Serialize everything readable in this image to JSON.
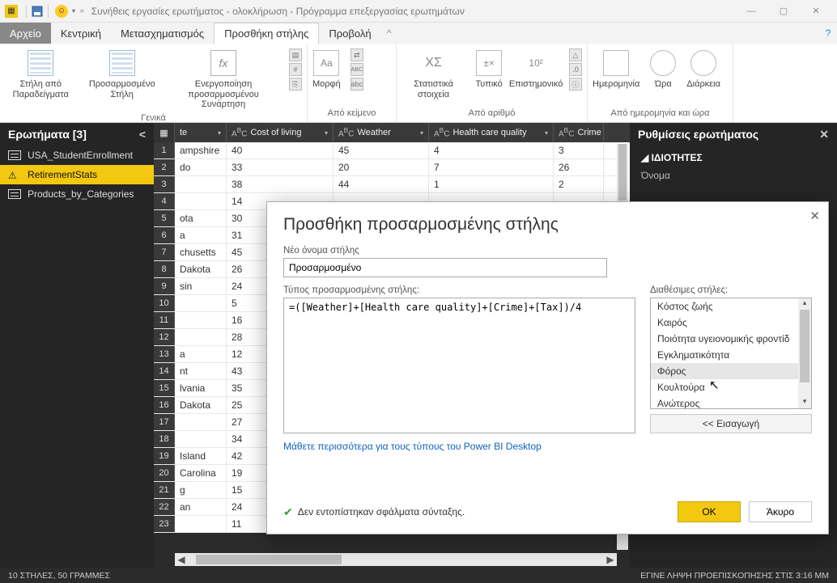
{
  "title": "Συνήθεις εργασίες ερωτήματος - ολοκλήρωση - Πρόγραμμα επεξεργασίας ερωτημάτων",
  "menu": {
    "file": "Αρχείο",
    "home": "Κεντρική",
    "transform": "Μετασχηματισμός",
    "add": "Προσθήκη στήλης",
    "view": "Προβολή"
  },
  "ribbon": {
    "g_general": "Γενικά",
    "g_text": "Από κείμενο",
    "g_number": "Από αριθμό",
    "g_date": "Από ημερομηνία και ώρα",
    "col_examples": "Στήλη από Παραδείγματα",
    "custom_col": "Προσαρμοσμένο Στήλη",
    "invoke": "Ενεργοποίηση προσαρμοσμένου Συνάρτηση",
    "format": "Μορφή",
    "stats": "Στατιστικά στοιχεία",
    "standard": "Τυπικό",
    "scientific": "Επιστημονικό",
    "date": "Ημερομηνία",
    "time": "Ώρα",
    "duration": "Διάρκεια"
  },
  "queries": {
    "header": "Ερωτήματα [3]",
    "items": [
      "USA_StudentEnrollment",
      "RetirementStats",
      "Products_by_Categories"
    ]
  },
  "columns": [
    "te",
    "Cost of living",
    "Weather",
    "Health care quality",
    "Crime"
  ],
  "rows": [
    [
      "ampshire",
      "40",
      "45",
      "4",
      "3"
    ],
    [
      "do",
      "33",
      "20",
      "7",
      "26"
    ],
    [
      "",
      "38",
      "44",
      "1",
      "2"
    ],
    [
      "",
      "14",
      "",
      "",
      ""
    ],
    [
      "ota",
      "30",
      "",
      "",
      ""
    ],
    [
      "a",
      "31",
      "",
      "",
      ""
    ],
    [
      "chusetts",
      "45",
      "",
      "",
      ""
    ],
    [
      "Dakota",
      "26",
      "",
      "",
      ""
    ],
    [
      "sin",
      "24",
      "",
      "",
      ""
    ],
    [
      "",
      "5",
      "",
      "",
      ""
    ],
    [
      "",
      "16",
      "",
      "",
      ""
    ],
    [
      "",
      "28",
      "",
      "",
      ""
    ],
    [
      "a",
      "12",
      "",
      "",
      ""
    ],
    [
      "nt",
      "43",
      "",
      "",
      ""
    ],
    [
      "lvania",
      "35",
      "",
      "",
      ""
    ],
    [
      "Dakota",
      "25",
      "",
      "",
      ""
    ],
    [
      "",
      "27",
      "",
      "",
      ""
    ],
    [
      "",
      "34",
      "",
      "",
      ""
    ],
    [
      "Island",
      "42",
      "",
      "",
      ""
    ],
    [
      "Carolina",
      "19",
      "",
      "",
      ""
    ],
    [
      "g",
      "15",
      "",
      "",
      ""
    ],
    [
      "an",
      "24",
      "",
      "",
      ""
    ],
    [
      "",
      "11",
      "",
      "",
      ""
    ]
  ],
  "settings": {
    "header": "Ρυθμίσεις ερωτήματος",
    "properties": "ΙΔΙΟΤΗΤΕΣ",
    "name": "Όνομα"
  },
  "status": {
    "left": "10 ΣΤΗΛΕΣ, 50 ΓΡΑΜΜΕΣ",
    "right": "ΕΓΙΝΕ ΛΗΨΗ ΠΡΟΕΠΙΣΚΟΠΗΣΗΣ ΣΤΙΣ 3:16 ΜΜ"
  },
  "dialog": {
    "title": "Προσθήκη προσαρμοσμένης στήλης",
    "name_label": "Νέο όνομα στήλης",
    "name_value": "Προσαρμοσμένο",
    "formula_label": "Τύπος προσαρμοσμένης στήλης:",
    "formula_value": "=([Weather]+[Health care quality]+[Crime]+[Tax])/4",
    "avail_label": "Διαθέσιμες στήλες:",
    "avail": [
      "Κόστος ζωής",
      "Καιρός",
      "Ποιότητα υγειονομικής φροντίδ",
      "Εγκληματικότητα",
      "Φόρος",
      "Κουλτούρα",
      "Ανώτερος"
    ],
    "insert": "<< Εισαγωγή",
    "link": "Μάθετε περισσότερα για τους τύπους του Power BI Desktop",
    "no_errors": "Δεν εντοπίστηκαν σφάλματα σύνταξης.",
    "ok": "OK",
    "cancel": "Άκυρο"
  }
}
